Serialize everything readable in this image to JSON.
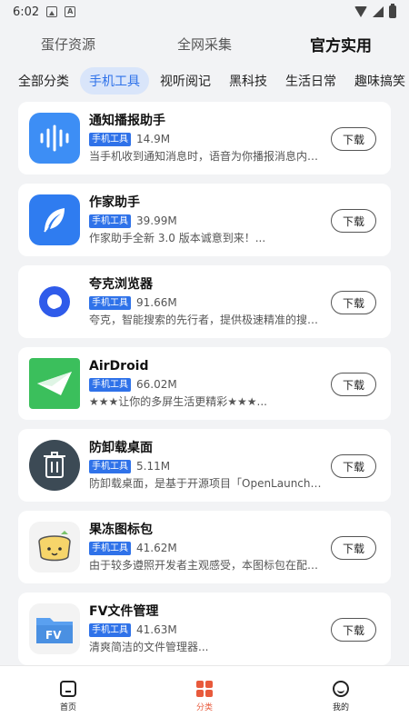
{
  "status": {
    "time": "6:02"
  },
  "top_tabs": [
    "蛋仔资源",
    "全网采集",
    "官方实用"
  ],
  "categories": [
    "全部分类",
    "手机工具",
    "视听阅记",
    "黑科技",
    "生活日常",
    "趣味搞笑"
  ],
  "download_label": "下载",
  "apps": [
    {
      "name": "通知播报助手",
      "badge": "手机工具",
      "size": "14.9M",
      "desc": "当手机收到通知消息时，语音为你播报消息内容...",
      "icon": "voice-wave-icon",
      "color": "#3d8ef5"
    },
    {
      "name": "作家助手",
      "badge": "手机工具",
      "size": "39.99M",
      "desc": "作家助手全新 3.0 版本诚意到来！...",
      "icon": "feather-icon",
      "color": "#2f7cf0"
    },
    {
      "name": "夸克浏览器",
      "badge": "手机工具",
      "size": "91.66M",
      "desc": "夸克，智能搜索的先行者，提供极速精准的搜索...",
      "icon": "quark-icon",
      "color": "#2f5bea"
    },
    {
      "name": "AirDroid",
      "badge": "手机工具",
      "size": "66.02M",
      "desc": "★★★让你的多屏生活更精彩★★★...",
      "icon": "paper-plane-icon",
      "color": "#3bbf5c"
    },
    {
      "name": "防卸载桌面",
      "badge": "手机工具",
      "size": "5.11M",
      "desc": "防卸载桌面，是基于开源项目「OpenLauncher...",
      "icon": "trash-icon",
      "color": "#3c4a55"
    },
    {
      "name": "果冻图标包",
      "badge": "手机工具",
      "size": "41.62M",
      "desc": "由于较多遵照开发者主观感受，本图标包在配色...",
      "icon": "jelly-icon",
      "color": "#f6d56a"
    },
    {
      "name": "FV文件管理",
      "badge": "手机工具",
      "size": "41.63M",
      "desc": "清爽简洁的文件管理器...",
      "icon": "folder-icon",
      "color": "#4a90e2"
    }
  ],
  "bottom_nav": [
    "首页",
    "分类",
    "我的"
  ]
}
